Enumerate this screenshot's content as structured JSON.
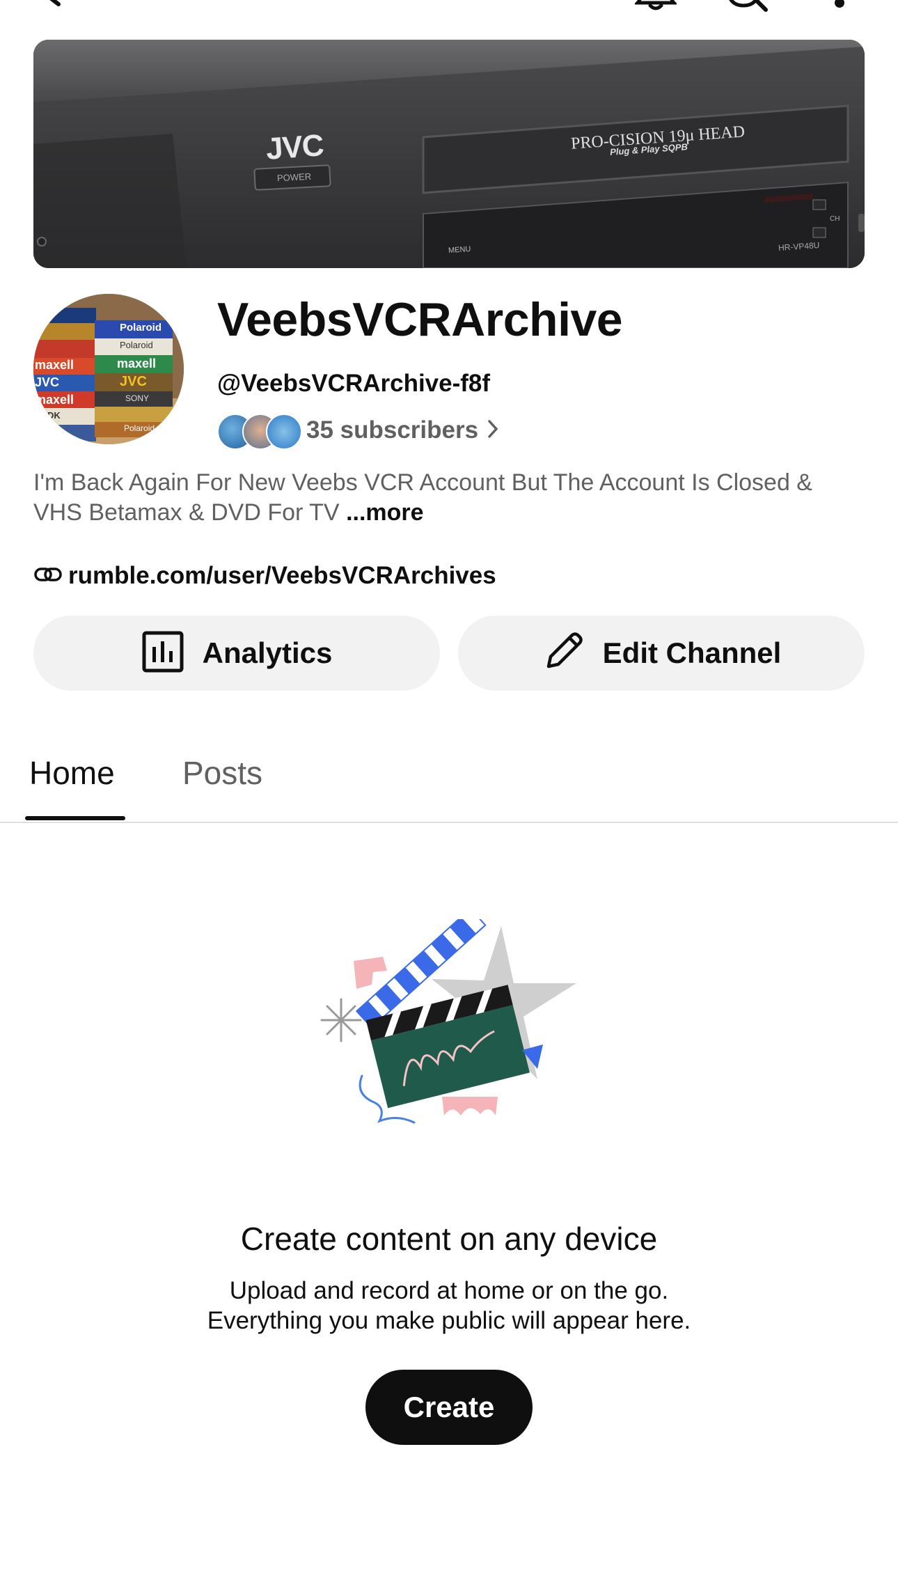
{
  "header": {
    "back_icon": "back-arrow-icon",
    "notifications_icon": "bell-icon",
    "search_icon": "search-icon",
    "more_icon": "more-vert-icon"
  },
  "banner": {
    "brand": "JVC",
    "power_label": "POWER",
    "head_label": "PRO-CISION 19μ HEAD",
    "head_sub": "Plug & Play SQPB",
    "menu_label": "MENU",
    "model_label": "HR-VP48U",
    "ch_label": "CH"
  },
  "avatar": {
    "tape_labels": [
      "Polaroid",
      "Polaroid",
      "maxell",
      "JVC",
      "SONY",
      "Polaroid",
      "maxell",
      "JVC",
      "maxell",
      "TDK"
    ]
  },
  "channel": {
    "name": "VeebsVCRArchive",
    "handle": "@VeebsVCRArchive-f8f",
    "subscribers": "35 subscribers",
    "description": "I'm Back Again For New Veebs VCR Account But The Account Is Closed & VHS Betamax & DVD For TV",
    "more_label": "...more",
    "link": "rumble.com/user/VeebsVCRArchives"
  },
  "actions": {
    "analytics_label": "Analytics",
    "edit_label": "Edit Channel"
  },
  "tabs": [
    {
      "label": "Home",
      "active": true
    },
    {
      "label": "Posts",
      "active": false
    }
  ],
  "empty_state": {
    "title": "Create content on any device",
    "line1": "Upload and record at home or on the go.",
    "line2": "Everything you make public will appear here.",
    "button": "Create"
  },
  "colors": {
    "text_primary": "#0f0f0f",
    "text_secondary": "#606060",
    "pill_bg": "#f2f2f2",
    "create_bg": "#0f0f0f"
  }
}
